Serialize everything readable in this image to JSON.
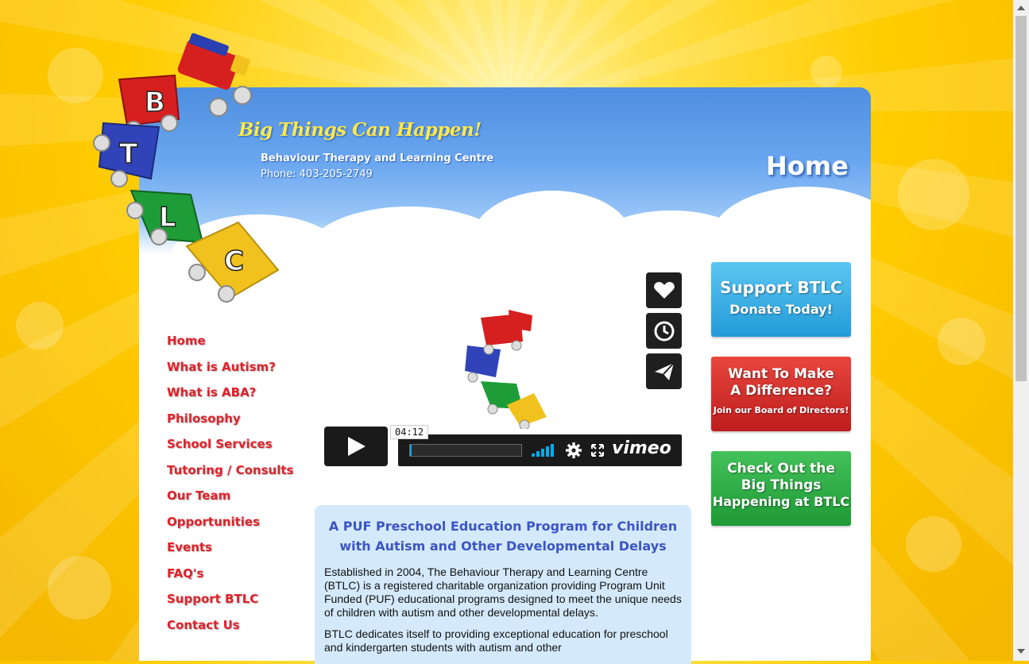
{
  "header": {
    "tagline": "Big Things Can Happen!",
    "org_name": "Behaviour Therapy and Learning Centre",
    "phone": "Phone: 403-205-2749",
    "page_title": "Home"
  },
  "logo": {
    "letters": [
      "B",
      "T",
      "L",
      "C"
    ]
  },
  "nav": {
    "items": [
      {
        "label": "Home"
      },
      {
        "label": "What is Autism?"
      },
      {
        "label": "What is ABA?"
      },
      {
        "label": "Philosophy"
      },
      {
        "label": "School Services"
      },
      {
        "label": "Tutoring / Consults"
      },
      {
        "label": "Our Team"
      },
      {
        "label": "Opportunities"
      },
      {
        "label": "Events"
      },
      {
        "label": "FAQ's"
      },
      {
        "label": "Support BTLC"
      },
      {
        "label": "Contact Us"
      }
    ]
  },
  "video": {
    "duration": "04:12",
    "brand": "vimeo",
    "side_icons": [
      "heart-icon",
      "clock-icon",
      "send-icon"
    ]
  },
  "intro": {
    "heading_line1": "A PUF Preschool Education Program for Children",
    "heading_line2": "with Autism and Other Developmental Delays",
    "paragraph1": "Established in 2004, The Behaviour Therapy and Learning Centre (BTLC) is a registered charitable organization providing Program Unit Funded (PUF) educational programs designed to meet the unique needs of children with autism and other developmental delays.",
    "paragraph2": "BTLC dedicates itself to providing exceptional education for preschool and kindergarten students with autism and other"
  },
  "promos": {
    "donate": {
      "line1": "Support BTLC",
      "line2": "Donate Today!"
    },
    "board": {
      "line1": "Want To Make",
      "line2": "A Difference?",
      "line3": "Join our Board of Directors!"
    },
    "happening": {
      "line1": "Check Out the",
      "line2": "Big Things",
      "line3": "Happening at BTLC"
    }
  },
  "colors": {
    "nav_red": "#e0222b",
    "heading_blue": "#3b55c4",
    "intro_bg": "#d4e9fb",
    "header_blue": "#4f8fe0",
    "promo_blue": "#229bd8",
    "promo_red": "#bd1d1d",
    "promo_green": "#1f9a36"
  }
}
